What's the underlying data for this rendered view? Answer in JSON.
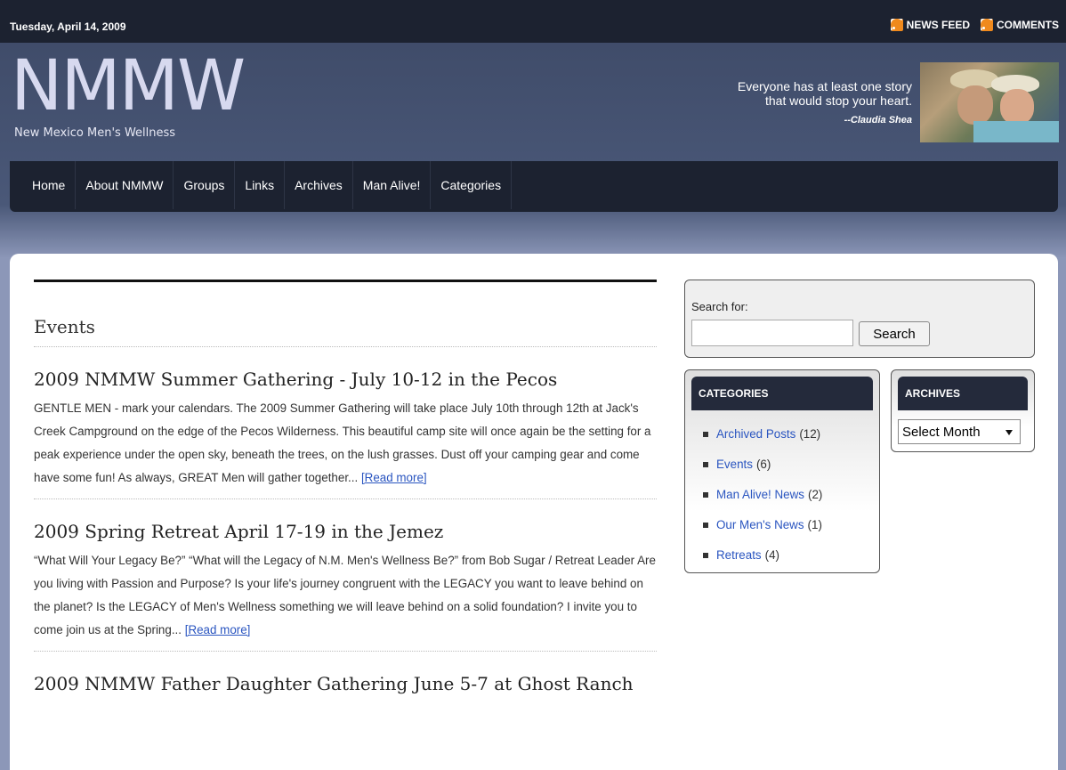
{
  "topbar": {
    "date": "Tuesday, April 14, 2009",
    "feeds": [
      {
        "label": "NEWS FEED",
        "icon": "rss-icon"
      },
      {
        "label": "COMMENTS",
        "icon": "rss-icon"
      }
    ]
  },
  "header": {
    "logo_big": "NMMW",
    "logo_small": "New Mexico Men's Wellness",
    "quote_line1": "Everyone has at least one story",
    "quote_line2": "that would stop your heart.",
    "quote_cite": "--Claudia Shea"
  },
  "nav": {
    "items": [
      "Home",
      "About NMMW",
      "Groups",
      "Links",
      "Archives",
      "Man Alive!",
      "Categories"
    ]
  },
  "main": {
    "section_title": "Events",
    "posts": [
      {
        "title": "2009 NMMW Summer Gathering - July 10-12 in the Pecos",
        "excerpt": "GENTLE MEN - mark your calendars. The 2009 Summer Gathering will take place July 10th through 12th at Jack's Creek Campground on the edge of the Pecos Wilderness. This beautiful camp site will once again be the setting for a peak experience under the open sky, beneath the trees, on the lush grasses. Dust off your camping gear and come have some fun! As always, GREAT Men will gather together...",
        "read_more": "[Read more]"
      },
      {
        "title": "2009 Spring Retreat April 17-19 in the Jemez",
        "excerpt": "“What Will Your Legacy Be?” “What will the Legacy of N.M. Men's Wellness Be?” from Bob Sugar / Retreat Leader Are you living with Passion and Purpose? Is your life's journey congruent with the LEGACY you want to leave behind on the planet? Is the LEGACY of Men's Wellness something we will leave behind on a solid foundation? I invite you to come join us at the Spring...",
        "read_more": "[Read more]"
      },
      {
        "title": "2009 NMMW Father Daughter Gathering June 5-7 at Ghost Ranch"
      }
    ]
  },
  "sidebar": {
    "search_label": "Search for:",
    "search_value": "",
    "search_button": "Search",
    "categories_title": "CATEGORIES",
    "categories": [
      {
        "name": "Archived Posts",
        "count": "(12)"
      },
      {
        "name": "Events",
        "count": "(6)"
      },
      {
        "name": "Man Alive! News",
        "count": "(2)"
      },
      {
        "name": "Our Men's News",
        "count": "(1)"
      },
      {
        "name": "Retreats",
        "count": "(4)"
      }
    ],
    "archives_title": "ARCHIVES",
    "archives_select": "Select Month"
  },
  "colors": {
    "topbar_bg": "#1c2230",
    "nav_bg": "#1c2230",
    "link": "#2a55c0",
    "rss": "#f08a1d"
  }
}
